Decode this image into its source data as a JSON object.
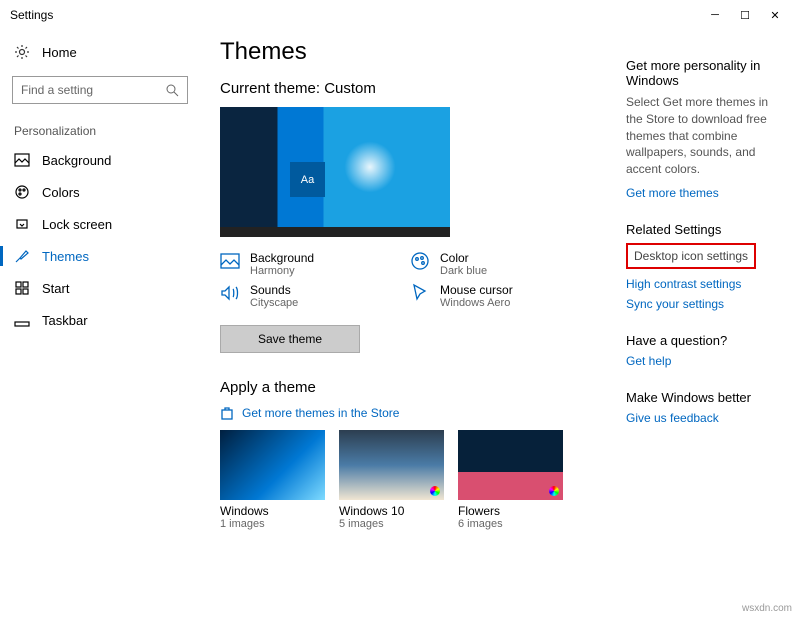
{
  "window": {
    "title": "Settings"
  },
  "sidebar": {
    "home": "Home",
    "search_placeholder": "Find a setting",
    "section": "Personalization",
    "items": [
      {
        "label": "Background"
      },
      {
        "label": "Colors"
      },
      {
        "label": "Lock screen"
      },
      {
        "label": "Themes"
      },
      {
        "label": "Start"
      },
      {
        "label": "Taskbar"
      }
    ]
  },
  "main": {
    "title": "Themes",
    "current_theme_label": "Current theme: Custom",
    "preview_tile": "Aa",
    "props": {
      "background": {
        "label": "Background",
        "value": "Harmony"
      },
      "color": {
        "label": "Color",
        "value": "Dark blue"
      },
      "sounds": {
        "label": "Sounds",
        "value": "Cityscape"
      },
      "cursor": {
        "label": "Mouse cursor",
        "value": "Windows Aero"
      }
    },
    "save_btn": "Save theme",
    "apply_title": "Apply a theme",
    "store_link": "Get more themes in the Store",
    "themes": [
      {
        "name": "Windows",
        "count": "1 images"
      },
      {
        "name": "Windows 10",
        "count": "5 images"
      },
      {
        "name": "Flowers",
        "count": "6 images"
      }
    ]
  },
  "right": {
    "personality_heading": "Get more personality in Windows",
    "personality_text": "Select Get more themes in the Store to download free themes that combine wallpapers, sounds, and accent colors.",
    "personality_link": "Get more themes",
    "related_heading": "Related Settings",
    "desktop_icon": "Desktop icon settings",
    "high_contrast": "High contrast settings",
    "sync": "Sync your settings",
    "question_heading": "Have a question?",
    "get_help": "Get help",
    "better_heading": "Make Windows better",
    "feedback": "Give us feedback"
  },
  "watermark": "wsxdn.com"
}
